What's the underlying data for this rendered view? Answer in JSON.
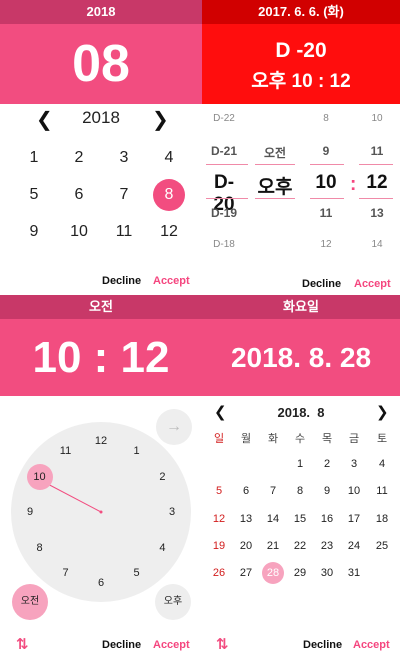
{
  "panel1": {
    "status_bar": "2018",
    "header": "08",
    "year": "2018",
    "prev": "❮",
    "next": "❯",
    "months": [
      "1",
      "2",
      "3",
      "4",
      "5",
      "6",
      "7",
      "8",
      "9",
      "10",
      "11",
      "12"
    ],
    "selected_month": "8",
    "decline": "Decline",
    "accept": "Accept"
  },
  "panel2": {
    "status_bar": "2017. 6. 6. (화)",
    "header_line1": "D -20",
    "header_line2": "오후 10 : 12",
    "col_dday": [
      "D-22",
      "D-21",
      "D-20",
      "D-19",
      "D-18"
    ],
    "col_ampm": [
      "오전",
      "오후"
    ],
    "col_hour": [
      "8",
      "9",
      "10",
      "11",
      "12"
    ],
    "col_minute": [
      "10",
      "11",
      "12",
      "13",
      "14"
    ],
    "colon": ":",
    "decline": "Decline",
    "accept": "Accept"
  },
  "panel3": {
    "status_bar": "오전",
    "header": "10 : 12",
    "clock_numbers": [
      "12",
      "1",
      "2",
      "3",
      "4",
      "5",
      "6",
      "7",
      "8",
      "9",
      "10",
      "11"
    ],
    "selected_hour": "10",
    "next_arrow": "→",
    "am": "오전",
    "pm": "오후",
    "swap_icon": "⇅",
    "decline": "Decline",
    "accept": "Accept"
  },
  "panel4": {
    "status_bar": "화요일",
    "header": "2018. 8. 28",
    "month_label": "2018.  8",
    "prev": "❮",
    "next": "❯",
    "weekdays": [
      "일",
      "월",
      "화",
      "수",
      "목",
      "금",
      "토"
    ],
    "weeks": [
      [
        "",
        "",
        "",
        "1",
        "2",
        "3",
        "4"
      ],
      [
        "5",
        "6",
        "7",
        "8",
        "9",
        "10",
        "11"
      ],
      [
        "12",
        "13",
        "14",
        "15",
        "16",
        "17",
        "18"
      ],
      [
        "19",
        "20",
        "21",
        "22",
        "23",
        "24",
        "25"
      ],
      [
        "26",
        "27",
        "28",
        "29",
        "30",
        "31",
        ""
      ]
    ],
    "selected_day": "28",
    "swap_icon": "⇅",
    "decline": "Decline",
    "accept": "Accept"
  },
  "colors": {
    "accent": "#f24d80",
    "accent_dark": "#c83868",
    "red_header": "#ff0d0d",
    "red_bar": "#d10000",
    "highlight": "#f7a3be",
    "sunday": "#d21d1d"
  }
}
